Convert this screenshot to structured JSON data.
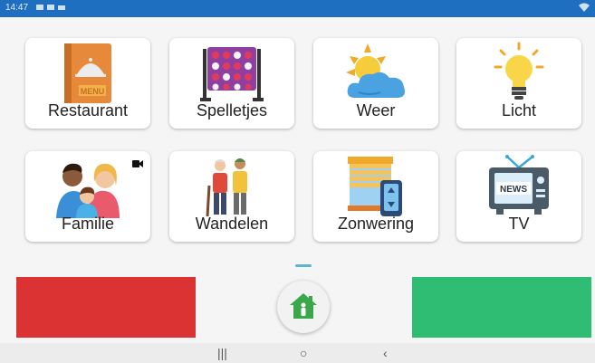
{
  "status": {
    "time": "14:47"
  },
  "tiles": [
    {
      "label": "Restaurant",
      "icon": "restaurant-menu-icon"
    },
    {
      "label": "Spelletjes",
      "icon": "connect-four-icon"
    },
    {
      "label": "Weer",
      "icon": "weather-sun-cloud-icon"
    },
    {
      "label": "Licht",
      "icon": "lightbulb-icon"
    },
    {
      "label": "Familie",
      "icon": "family-icon"
    },
    {
      "label": "Wandelen",
      "icon": "walking-people-icon"
    },
    {
      "label": "Zonwering",
      "icon": "sunshade-blinds-icon"
    },
    {
      "label": "TV",
      "icon": "tv-news-icon"
    }
  ],
  "colors": {
    "red_button": "#db3333",
    "green_button": "#2ebd73",
    "statusbar": "#1f6fc0",
    "home_icon": "#3aa84a"
  },
  "nav": {
    "recents": "|||",
    "home": "○",
    "back": "‹"
  }
}
